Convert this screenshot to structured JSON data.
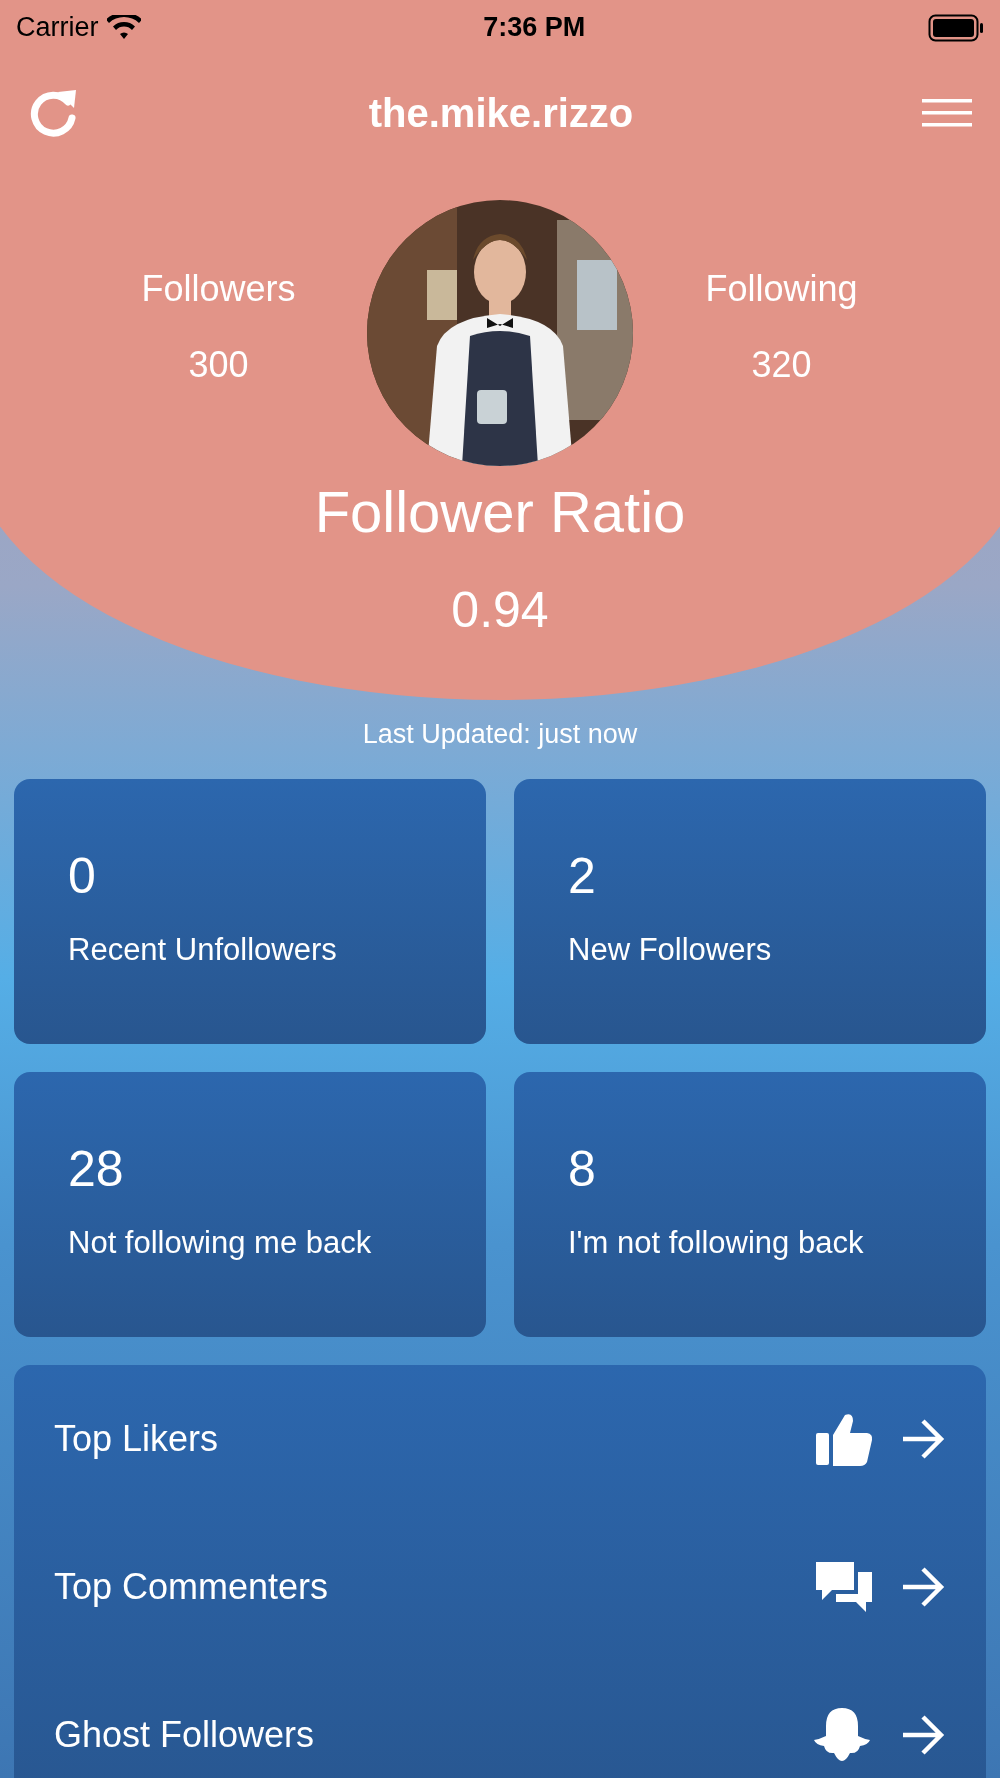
{
  "status_bar": {
    "carrier": "Carrier",
    "time": "7:36 PM"
  },
  "header": {
    "title": "the.mike.rizzo"
  },
  "profile": {
    "followers": {
      "label": "Followers",
      "value": "300"
    },
    "following": {
      "label": "Following",
      "value": "320"
    },
    "ratio_label": "Follower Ratio",
    "ratio": "0.94"
  },
  "last_updated": "Last Updated: just now",
  "stats": [
    {
      "value": "0",
      "label": "Recent Unfollowers"
    },
    {
      "value": "2",
      "label": "New Followers"
    },
    {
      "value": "28",
      "label": "Not following me back"
    },
    {
      "value": "8",
      "label": "I'm not following back"
    }
  ],
  "links": [
    {
      "label": "Top Likers",
      "kind": "likes"
    },
    {
      "label": "Top Commenters",
      "kind": "comments"
    },
    {
      "label": "Ghost Followers",
      "kind": "ghost"
    }
  ]
}
